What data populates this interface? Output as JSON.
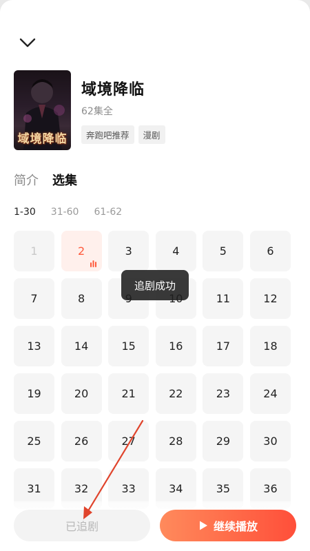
{
  "show": {
    "title": "域境降临",
    "cover_text": "域境降临",
    "episodes_total": "62集全",
    "tags": [
      "奔跑吧推荐",
      "漫剧"
    ]
  },
  "tabs": [
    "简介",
    "选集"
  ],
  "active_tab": 1,
  "ranges": [
    "1-30",
    "31-60",
    "61-62"
  ],
  "active_range": 0,
  "episodes": [
    {
      "label": "1",
      "state": "watched"
    },
    {
      "label": "2",
      "state": "current"
    },
    {
      "label": "3",
      "state": "normal"
    },
    {
      "label": "4",
      "state": "normal"
    },
    {
      "label": "5",
      "state": "normal"
    },
    {
      "label": "6",
      "state": "normal"
    },
    {
      "label": "7",
      "state": "normal"
    },
    {
      "label": "8",
      "state": "normal"
    },
    {
      "label": "9",
      "state": "normal"
    },
    {
      "label": "10",
      "state": "normal"
    },
    {
      "label": "11",
      "state": "normal"
    },
    {
      "label": "12",
      "state": "normal"
    },
    {
      "label": "13",
      "state": "normal"
    },
    {
      "label": "14",
      "state": "normal"
    },
    {
      "label": "15",
      "state": "normal"
    },
    {
      "label": "16",
      "state": "normal"
    },
    {
      "label": "17",
      "state": "normal"
    },
    {
      "label": "18",
      "state": "normal"
    },
    {
      "label": "19",
      "state": "normal"
    },
    {
      "label": "20",
      "state": "normal"
    },
    {
      "label": "21",
      "state": "normal"
    },
    {
      "label": "22",
      "state": "normal"
    },
    {
      "label": "23",
      "state": "normal"
    },
    {
      "label": "24",
      "state": "normal"
    },
    {
      "label": "25",
      "state": "normal"
    },
    {
      "label": "26",
      "state": "normal"
    },
    {
      "label": "27",
      "state": "normal"
    },
    {
      "label": "28",
      "state": "normal"
    },
    {
      "label": "29",
      "state": "normal"
    },
    {
      "label": "30",
      "state": "normal"
    },
    {
      "label": "31",
      "state": "normal"
    },
    {
      "label": "32",
      "state": "normal"
    },
    {
      "label": "33",
      "state": "normal"
    },
    {
      "label": "34",
      "state": "normal"
    },
    {
      "label": "35",
      "state": "normal"
    },
    {
      "label": "36",
      "state": "normal"
    }
  ],
  "toast": "追剧成功",
  "buttons": {
    "follow_label": "已追剧",
    "play_label": "继续播放"
  },
  "colors": {
    "accent": "#ff5a3c",
    "annotation_arrow": "#e0442c"
  },
  "icons": {
    "collapse": "chevron-down-icon",
    "play": "play-icon",
    "playing": "playing-bars-icon"
  }
}
